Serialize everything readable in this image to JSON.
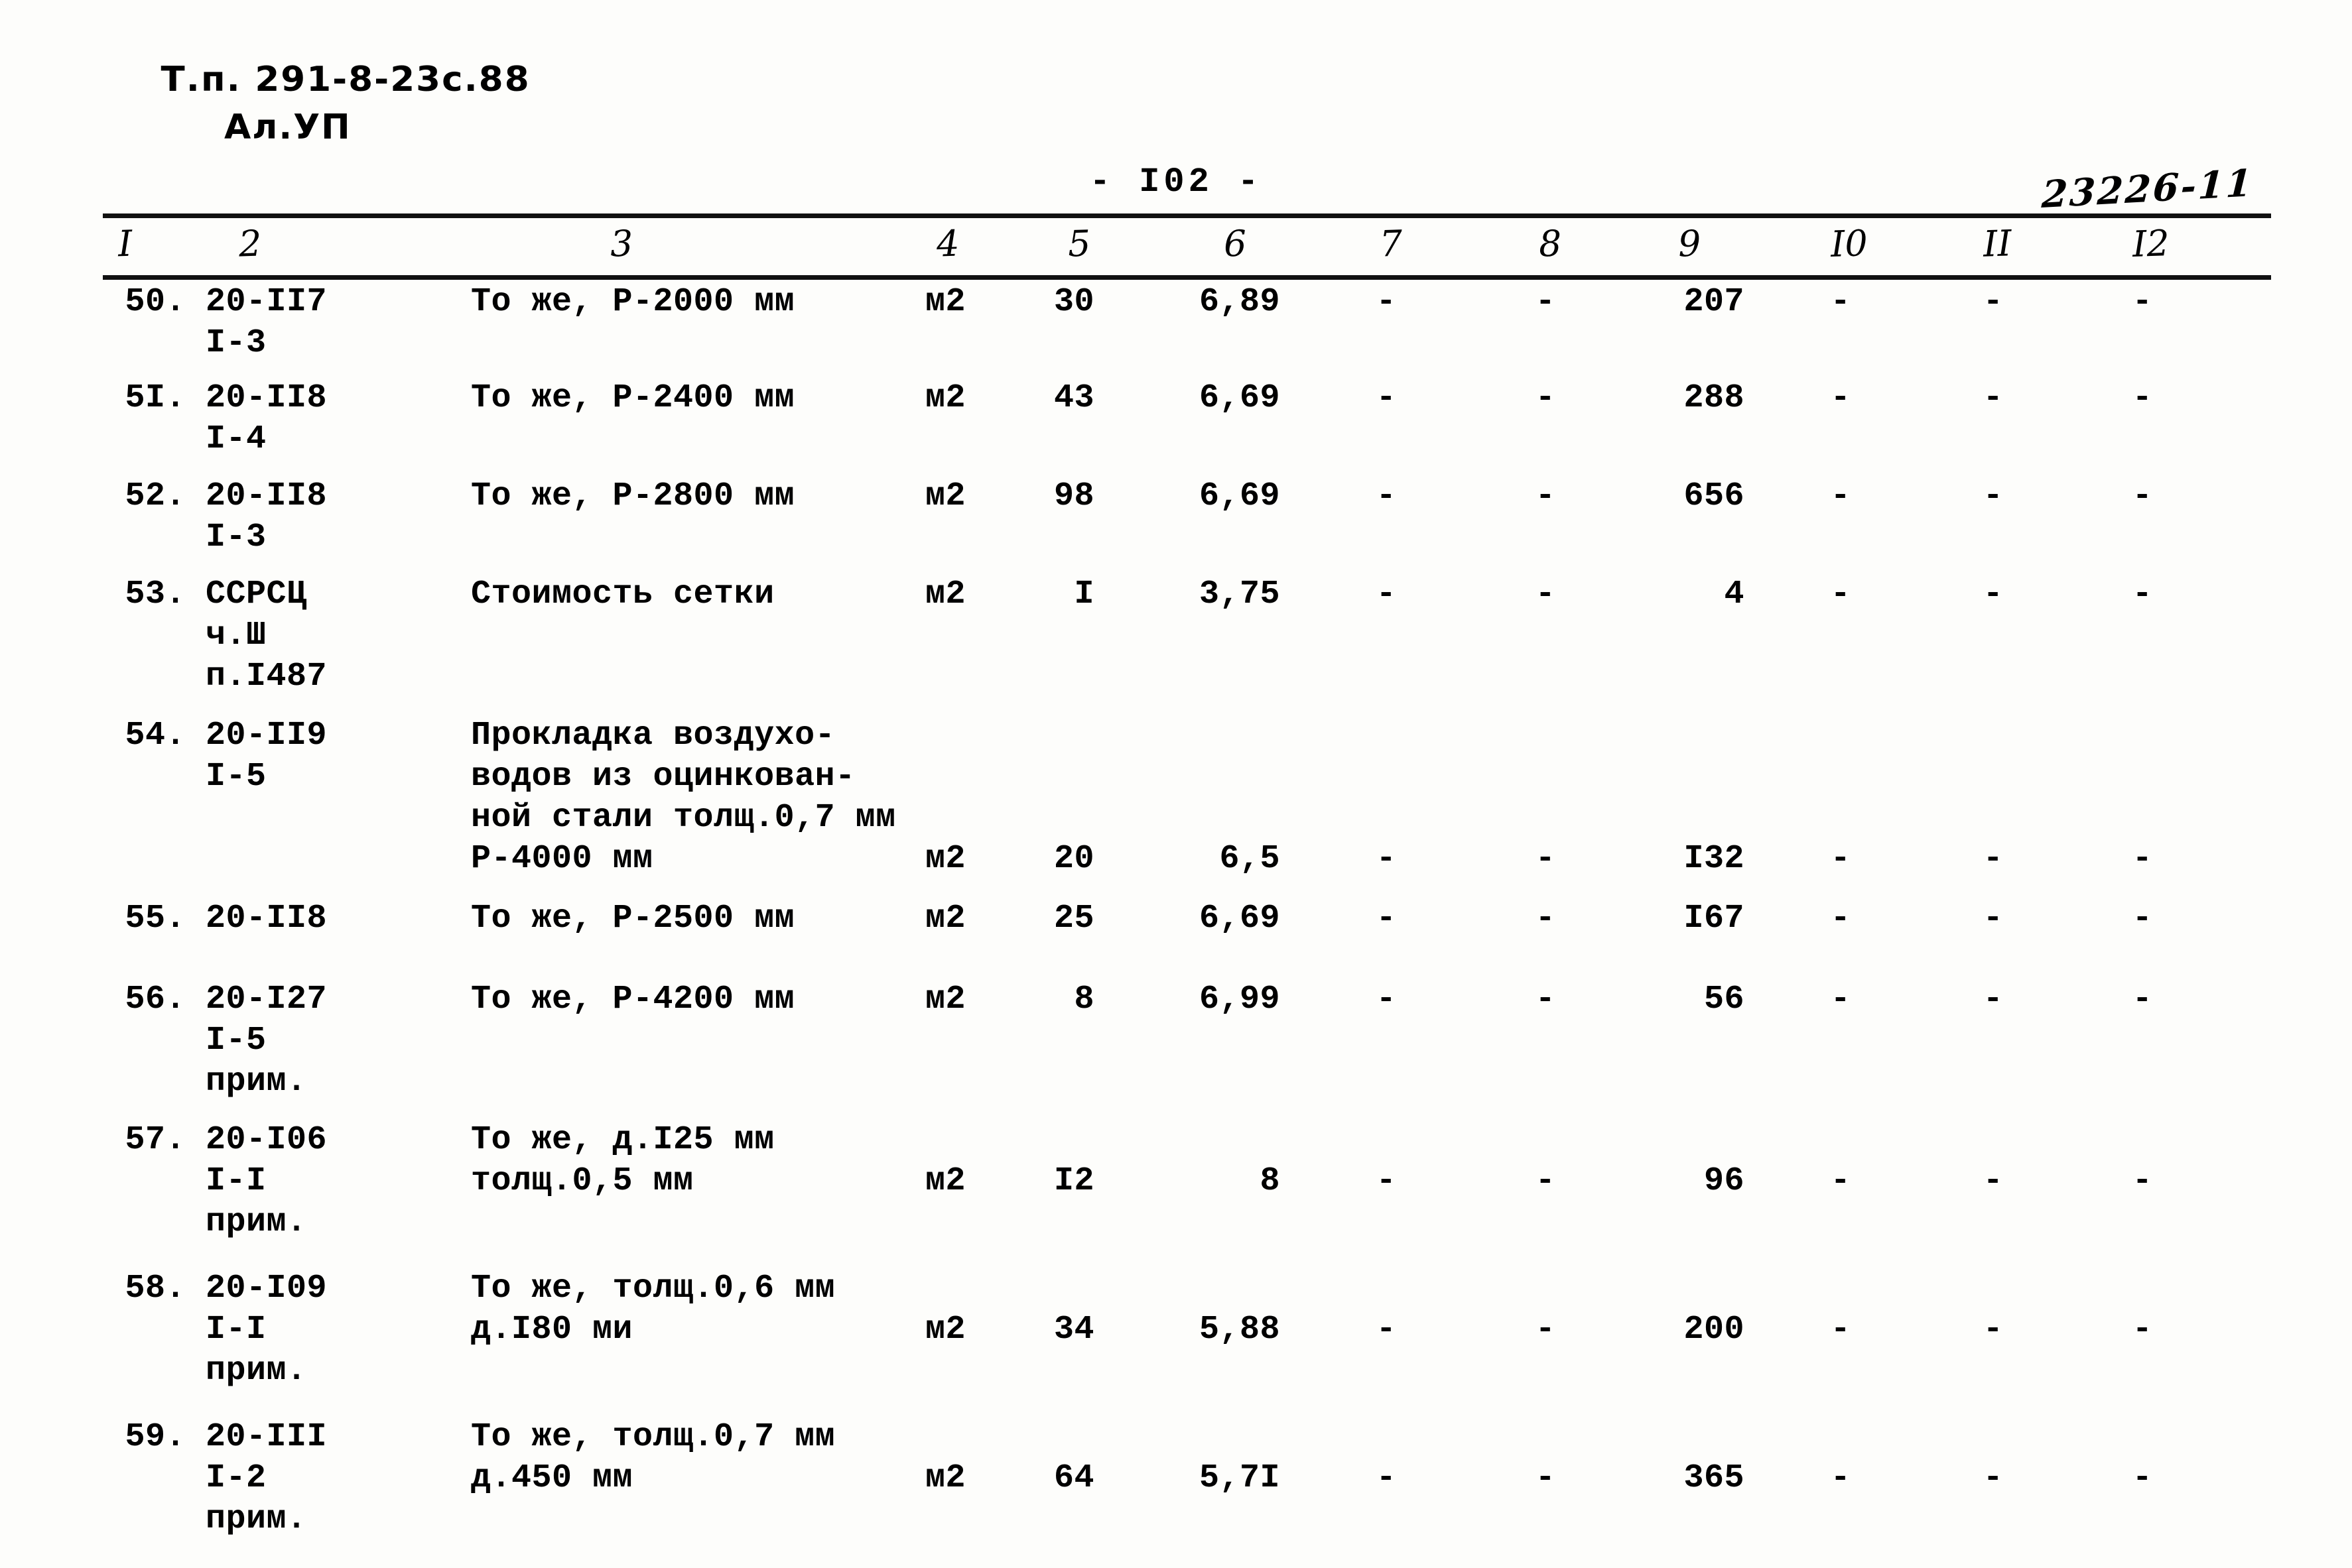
{
  "header": {
    "doc_code": "Т.п. 291-8-23с.88",
    "album": "Ал.УП",
    "page_number": "- I02 -",
    "stamp": "23226-11"
  },
  "table": {
    "column_headers": [
      "I",
      "2",
      "3",
      "4",
      "5",
      "6",
      "7",
      "8",
      "9",
      "I0",
      "II",
      "I2"
    ],
    "rows": [
      {
        "no": "50.",
        "code": "20-II7\nI-3",
        "desc": "То же, Р-2000 мм",
        "unit": "м2",
        "c5": "30",
        "c6": "6,89",
        "c7": "-",
        "c8": "-",
        "c9": "207",
        "c10": "-",
        "c11": "-",
        "c12": "-"
      },
      {
        "no": "5I.",
        "code": "20-II8\nI-4",
        "desc": "То же, Р-2400 мм",
        "unit": "м2",
        "c5": "43",
        "c6": "6,69",
        "c7": "-",
        "c8": "-",
        "c9": "288",
        "c10": "-",
        "c11": "-",
        "c12": "-"
      },
      {
        "no": "52.",
        "code": "20-II8\nI-3",
        "desc": "То же, Р-2800 мм",
        "unit": "м2",
        "c5": "98",
        "c6": "6,69",
        "c7": "-",
        "c8": "-",
        "c9": "656",
        "c10": "-",
        "c11": "-",
        "c12": "-"
      },
      {
        "no": "53.",
        "code": "ССРСЦ\nч.Ш\nп.I487",
        "desc": "Стоимость сетки",
        "unit": "м2",
        "c5": "I",
        "c6": "3,75",
        "c7": "-",
        "c8": "-",
        "c9": "4",
        "c10": "-",
        "c11": "-",
        "c12": "-"
      },
      {
        "no": "54.",
        "code": "20-II9\nI-5",
        "desc": "Прокладка воздухо-\nводов из оцинкован-\nной стали толщ.0,7 мм\nР-4000 мм",
        "unit": "м2",
        "c5": "20",
        "c6": "6,5",
        "c7": "-",
        "c8": "-",
        "c9": "I32",
        "c10": "-",
        "c11": "-",
        "c12": "-"
      },
      {
        "no": "55.",
        "code": "20-II8",
        "desc": "То же, Р-2500 мм",
        "unit": "м2",
        "c5": "25",
        "c6": "6,69",
        "c7": "-",
        "c8": "-",
        "c9": "I67",
        "c10": "-",
        "c11": "-",
        "c12": "-"
      },
      {
        "no": "56.",
        "code": "20-I27\nI-5\nприм.",
        "desc": "То же, Р-4200 мм",
        "unit": "м2",
        "c5": "8",
        "c6": "6,99",
        "c7": "-",
        "c8": "-",
        "c9": "56",
        "c10": "-",
        "c11": "-",
        "c12": "-"
      },
      {
        "no": "57.",
        "code": "20-I06\nI-I\nприм.",
        "desc": "То же, д.I25 мм\nтолщ.0,5 мм",
        "unit": "м2",
        "c5": "I2",
        "c6": "8",
        "c7": "-",
        "c8": "-",
        "c9": "96",
        "c10": "-",
        "c11": "-",
        "c12": "-"
      },
      {
        "no": "58.",
        "code": "20-I09\nI-I\nприм.",
        "desc": "То же, толщ.0,6 мм\nд.I80 ми",
        "unit": "м2",
        "c5": "34",
        "c6": "5,88",
        "c7": "-",
        "c8": "-",
        "c9": "200",
        "c10": "-",
        "c11": "-",
        "c12": "-"
      },
      {
        "no": "59.",
        "code": "20-III\nI-2\nприм.",
        "desc": "То же, толщ.0,7 мм\nд.450 мм",
        "unit": "м2",
        "c5": "64",
        "c6": "5,7I",
        "c7": "-",
        "c8": "-",
        "c9": "365",
        "c10": "-",
        "c11": "-",
        "c12": "-"
      }
    ]
  }
}
